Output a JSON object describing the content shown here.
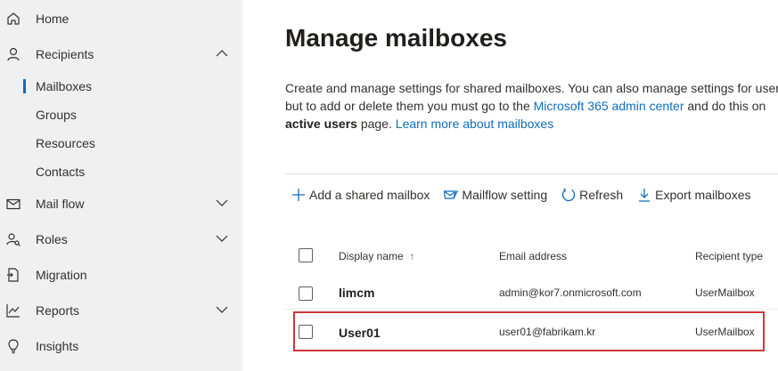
{
  "sidebar": {
    "items": [
      {
        "label": "Home",
        "icon": "home-icon"
      },
      {
        "label": "Recipients",
        "icon": "person-icon",
        "expanded": true
      },
      {
        "label": "Mailboxes",
        "sub": true,
        "active": true
      },
      {
        "label": "Groups",
        "sub": true
      },
      {
        "label": "Resources",
        "sub": true
      },
      {
        "label": "Contacts",
        "sub": true
      },
      {
        "label": "Mail flow",
        "icon": "mail-icon"
      },
      {
        "label": "Roles",
        "icon": "roles-icon"
      },
      {
        "label": "Migration",
        "icon": "migration-icon"
      },
      {
        "label": "Reports",
        "icon": "reports-icon"
      },
      {
        "label": "Insights",
        "icon": "lightbulb-icon"
      }
    ]
  },
  "main": {
    "title": "Manage mailboxes",
    "description": {
      "line1": "Create and manage settings for shared mailboxes. You can also manage settings for user m",
      "line2_a": "but to add or delete them you must go to the ",
      "line2_link": "Microsoft 365 admin center",
      "line2_b": " and do this on",
      "line3_bold": "active users",
      "line3_a": " page. ",
      "line3_link": "Learn more about mailboxes"
    },
    "toolbar": {
      "add": "Add a shared mailbox",
      "mailflow": "Mailflow setting",
      "refresh": "Refresh",
      "export": "Export mailboxes"
    },
    "table": {
      "headers": {
        "display_name": "Display name",
        "sort_indicator": "↑",
        "email": "Email address",
        "type": "Recipient type"
      },
      "rows": [
        {
          "name": "limcm",
          "email": "admin@kor7.onmicrosoft.com",
          "type": "UserMailbox"
        },
        {
          "name": "User01",
          "email": "user01@fabrikam.kr",
          "type": "UserMailbox"
        }
      ]
    }
  },
  "colors": {
    "accent": "#0f6cbd",
    "highlight_border": "#d13438",
    "sidebar_bg": "#f0f0f0"
  }
}
